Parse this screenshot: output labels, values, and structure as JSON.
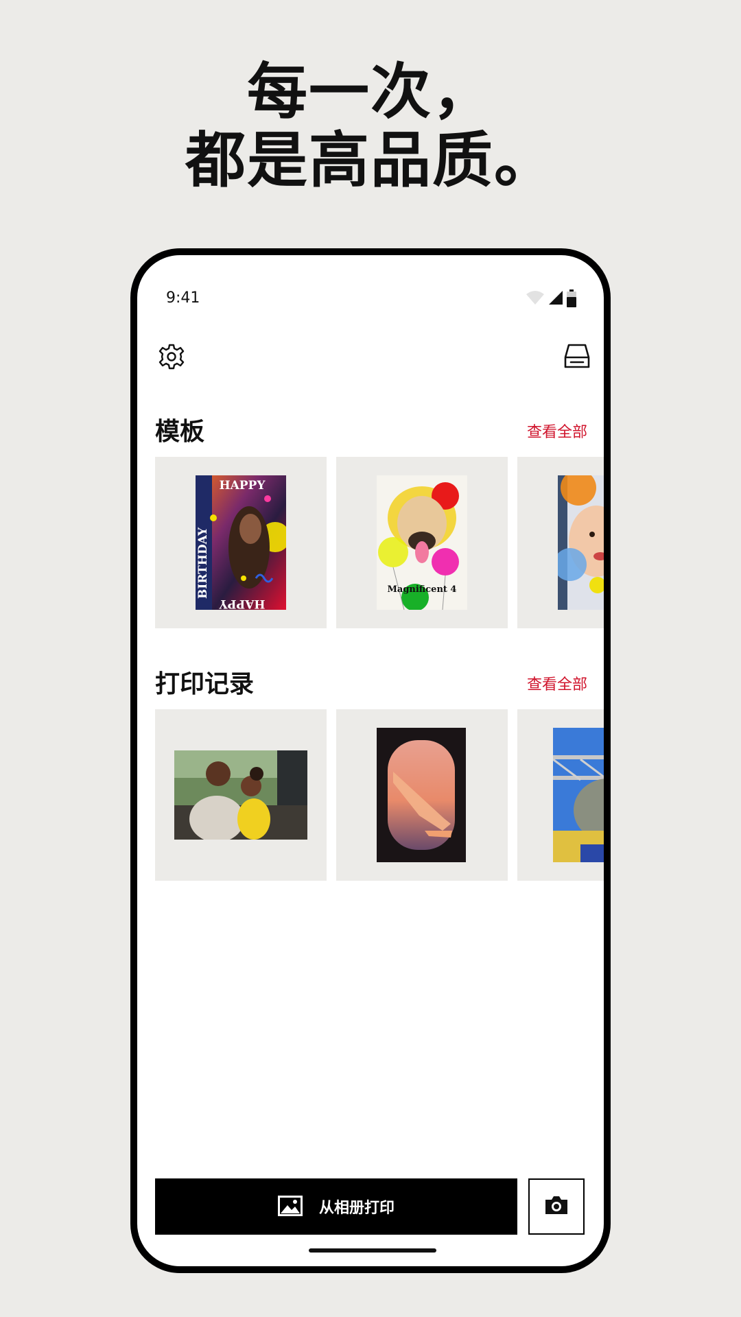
{
  "headline": {
    "line1": "每一次，",
    "line2": "都是高品质。"
  },
  "status_bar": {
    "time": "9:41"
  },
  "icons": {
    "settings": "gear-icon",
    "printer": "printer-icon",
    "album": "image-icon",
    "camera": "camera-icon"
  },
  "templates": {
    "title": "模板",
    "view_all": "查看全部",
    "items": [
      {
        "text_top": "HAPPY",
        "text_side": "BIRTHDAY",
        "text_bottom": "HAPPY"
      },
      {
        "caption": "Magnificent 4"
      },
      {}
    ]
  },
  "print_history": {
    "title": "打印记录",
    "view_all": "查看全部"
  },
  "bottom_bar": {
    "album_print_label": "从相册打印"
  },
  "colors": {
    "accent": "#d0142c",
    "background": "#ecebe8",
    "button": "#000000"
  }
}
